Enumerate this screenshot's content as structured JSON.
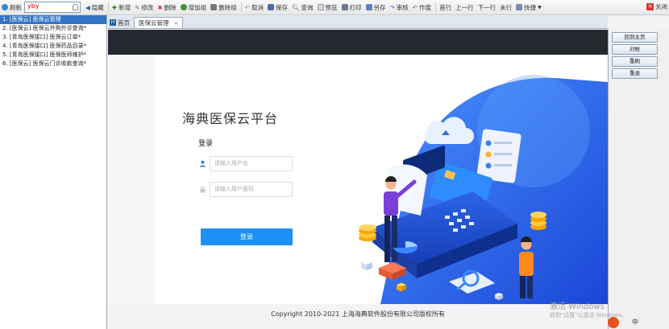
{
  "toolbar": {
    "refresh": "刷新",
    "search_value": "yby",
    "hide": "隐藏",
    "new": "新增",
    "edit": "修改",
    "delete": "删除",
    "add_group": "增加组",
    "delete_group": "删除组",
    "cancel": "取消",
    "save": "保存",
    "query": "查询",
    "preview": "预览",
    "print": "打印",
    "save_as": "另存",
    "audit": "审核",
    "void": "作废",
    "first": "首行",
    "prev": "上一行",
    "next": "下一行",
    "last": "末行",
    "quick": "快捷",
    "close": "关闭"
  },
  "sidebar": {
    "items": [
      {
        "label": "1. [医保云]   医保云管理"
      },
      {
        "label": "2. [医保云]   医保云外购外诊查询*"
      },
      {
        "label": "3. [青岛医保接口]   医保云订单*"
      },
      {
        "label": "4. [青岛医保接口]   医保药品目录*"
      },
      {
        "label": "5. [青岛医保接口]   医保医师维护*"
      },
      {
        "label": "6. [医保云]   医保云门诊收款查询*"
      }
    ]
  },
  "tabs": [
    {
      "label": "首页"
    },
    {
      "label": "医保云管理"
    }
  ],
  "login": {
    "platform_title": "海典医保云平台",
    "title": "登录",
    "username_placeholder": "请输入用户名",
    "password_placeholder": "请输入用户密码",
    "submit": "登录"
  },
  "footer": {
    "copyright": "Copyright 2010-2021 上海海典软件股份有限公司版权所有"
  },
  "right_panel": {
    "buttons": [
      {
        "label": "回到主页"
      },
      {
        "label": "对帐"
      },
      {
        "label": "重刷"
      },
      {
        "label": "重退"
      }
    ]
  },
  "watermark": {
    "line1": "激活 Windows",
    "line2": "转到\"设置\"以激活 Windows。"
  },
  "tray": {
    "ime": "中"
  },
  "colors": {
    "accent": "#1e90f5",
    "selected_row": "#3375c6",
    "top_band": "#25292f"
  }
}
